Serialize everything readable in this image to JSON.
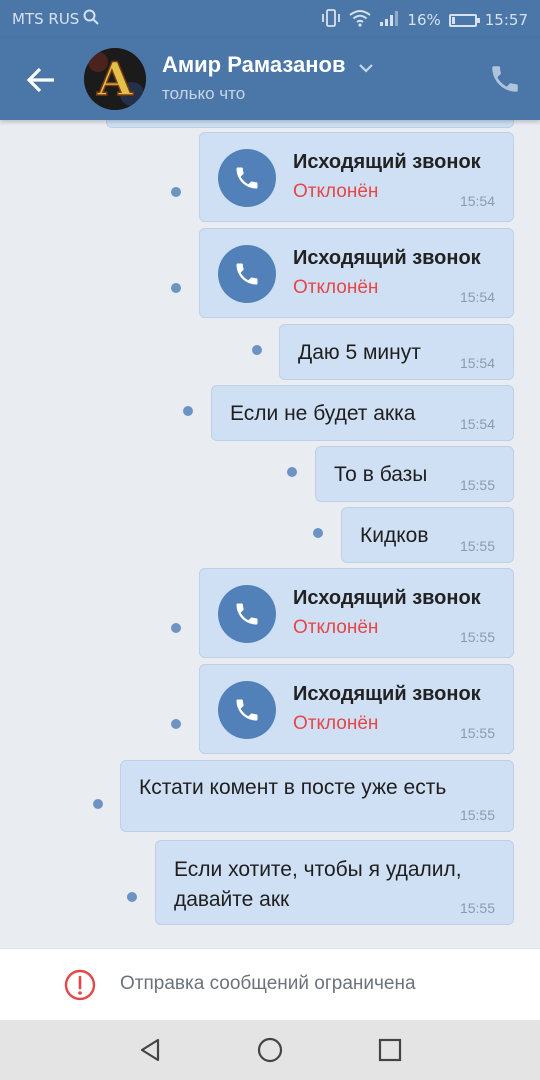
{
  "status_bar": {
    "carrier": "MTS RUS",
    "battery": "16%",
    "battery_level": 0.16,
    "time": "15:57"
  },
  "header": {
    "contact_name": "Амир Рамазанов",
    "presence": "только что",
    "avatar_letter": "A"
  },
  "messages": [
    {
      "type": "call",
      "title": "Исходящий звонок",
      "status": "Отклонён",
      "time": "15:54"
    },
    {
      "type": "call",
      "title": "Исходящий звонок",
      "status": "Отклонён",
      "time": "15:54"
    },
    {
      "type": "text",
      "text": "Даю 5 минут",
      "time": "15:54"
    },
    {
      "type": "text",
      "text": "Если не будет акка",
      "time": "15:54"
    },
    {
      "type": "text",
      "text": "То в базы",
      "time": "15:55"
    },
    {
      "type": "text",
      "text": "Кидков",
      "time": "15:55"
    },
    {
      "type": "call",
      "title": "Исходящий звонок",
      "status": "Отклонён",
      "time": "15:55"
    },
    {
      "type": "call",
      "title": "Исходящий звонок",
      "status": "Отклонён",
      "time": "15:55"
    },
    {
      "type": "text",
      "text": "Кстати комент в посте уже есть",
      "time": "15:55"
    },
    {
      "type": "text",
      "text_line1": "Если хотите, чтобы я удалил,",
      "text_line2": "давайте акк",
      "time": "15:55"
    }
  ],
  "restriction": {
    "label": "Отправка сообщений ограничена"
  },
  "colors": {
    "header": "#4a76a8",
    "bubble": "#cfe0f4",
    "declined": "#e64646",
    "call_circle": "#5181b8"
  }
}
